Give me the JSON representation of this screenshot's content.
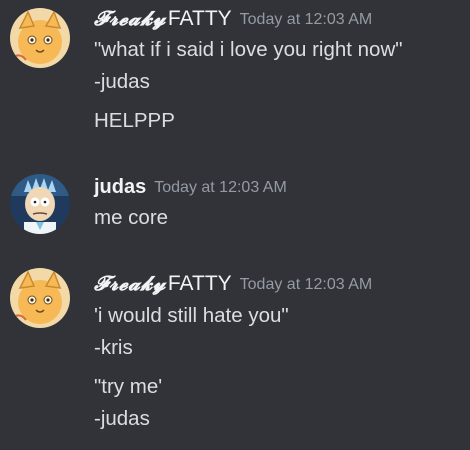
{
  "colors": {
    "background": "#313338",
    "username": "#f2f3f5",
    "timestamp": "#949ba4",
    "message_text": "#dbdee1"
  },
  "messages": [
    {
      "avatar_icon": "cartoon-cat-avatar-icon",
      "username_fancy": "𝓕𝓻𝓮𝓪𝓴𝔂",
      "username_plain": "FATTY",
      "timestamp": "Today at 12:03 AM",
      "lines": [
        "\"what if i said i love you right now\"",
        "-judas",
        "HELPPP"
      ]
    },
    {
      "avatar_icon": "rick-cartoon-avatar-icon",
      "username_fancy": "",
      "username_plain": "judas",
      "timestamp": "Today at 12:03 AM",
      "lines": [
        "me core"
      ]
    },
    {
      "avatar_icon": "cartoon-cat-avatar-icon",
      "username_fancy": "𝓕𝓻𝓮𝓪𝓴𝔂",
      "username_plain": "FATTY",
      "timestamp": "Today at 12:03 AM",
      "lines": [
        "'i would still hate you\"",
        "-kris",
        "\"try me'",
        "-judas"
      ]
    }
  ]
}
